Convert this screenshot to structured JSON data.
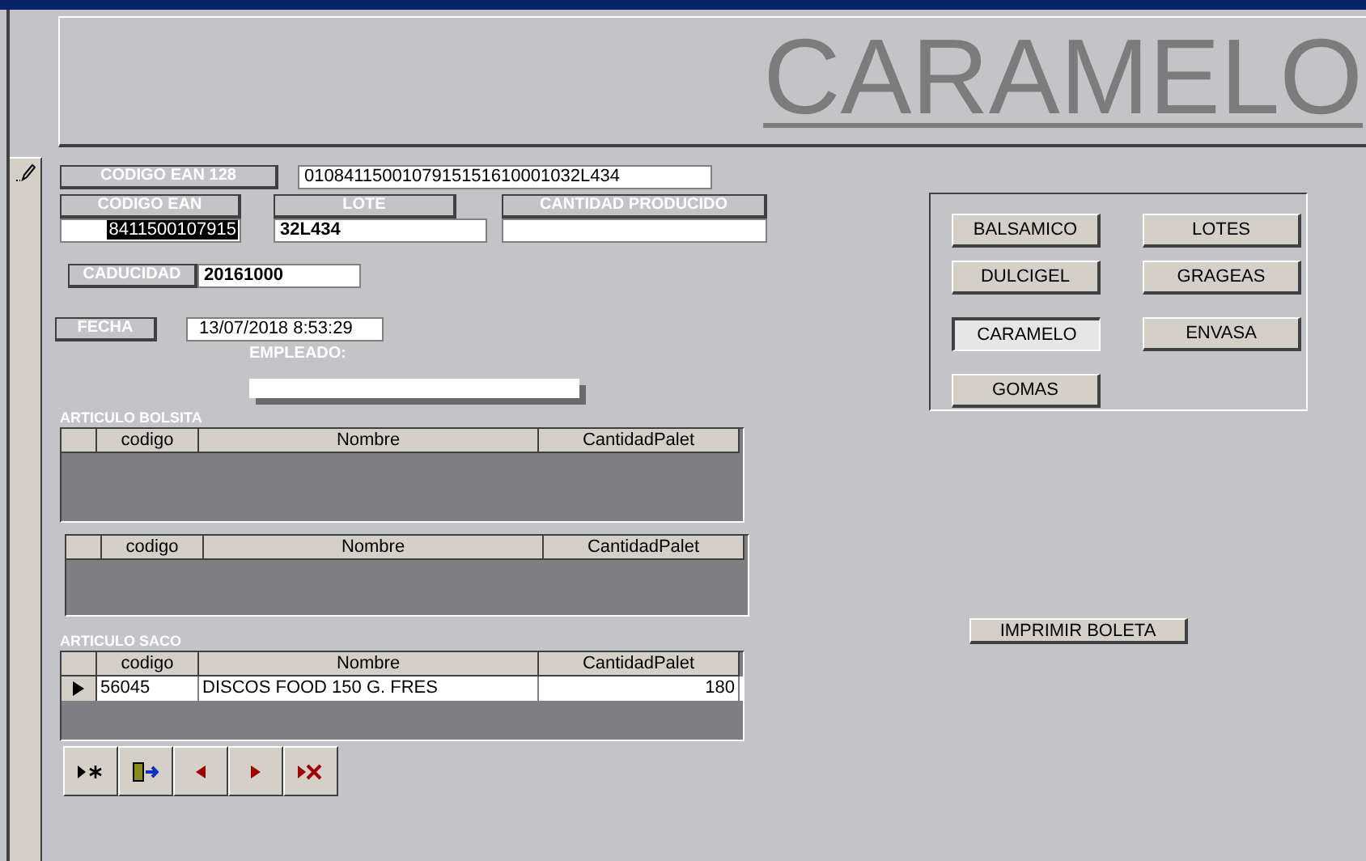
{
  "header": {
    "title": "CARAMELO"
  },
  "fields": {
    "ean128": {
      "label": "CODIGO EAN 128",
      "value": "0108411500107915151610001032L434"
    },
    "ean": {
      "label": "CODIGO EAN",
      "value": "8411500107915",
      "highlighted": true
    },
    "lote": {
      "label": "LOTE",
      "value": "32L434"
    },
    "cantidad": {
      "label": "CANTIDAD  PRODUCIDO"
    },
    "caducidad": {
      "label": "CADUCIDAD",
      "value": "20161000"
    },
    "fecha": {
      "label": "FECHA",
      "value": "13/07/2018 8:53:29"
    },
    "empleado": {
      "label": "EMPLEADO:"
    }
  },
  "grids": [
    {
      "title": "ARTICULO BOLSITA",
      "columns": [
        "codigo",
        "Nombre",
        "CantidadPalet"
      ]
    },
    {
      "columns": [
        "codigo",
        "Nombre",
        "CantidadPalet"
      ]
    },
    {
      "title": "ARTICULO SACO",
      "columns": [
        "codigo",
        "Nombre",
        "CantidadPalet"
      ],
      "rows": [
        {
          "selected": true,
          "cells": [
            "56045",
            "DISCOS FOOD 150 G. FRES",
            "180"
          ]
        }
      ]
    }
  ],
  "nav_buttons": [
    {
      "kind": "new"
    },
    {
      "kind": "exit"
    },
    {
      "kind": "prev"
    },
    {
      "kind": "next"
    },
    {
      "kind": "delete"
    }
  ],
  "category_buttons": [
    {
      "label": "BALSAMICO",
      "selected": false
    },
    {
      "label": "LOTES",
      "selected": false
    },
    {
      "label": "DULCIGEL",
      "selected": false
    },
    {
      "label": "GRAGEAS",
      "selected": false
    },
    {
      "label": "CARAMELO",
      "selected": true
    },
    {
      "label": "ENVASA",
      "selected": false
    },
    {
      "label": "GOMAS",
      "selected": false
    }
  ],
  "print_button": {
    "label": "IMPRIMIR BOLETA"
  }
}
